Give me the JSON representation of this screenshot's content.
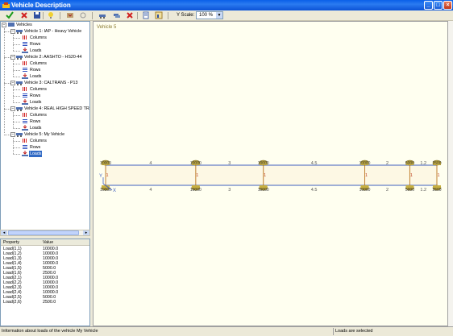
{
  "window": {
    "title": "Vehicle Description"
  },
  "toolbar": {
    "yscale_label": "Y Scale:",
    "yscale_value": "100 %"
  },
  "tree": {
    "root": "Vehicles",
    "vehicles": [
      {
        "label": "Vehicle 1: IAP - Heavy Vehicle",
        "children": [
          "Columns",
          "Rows",
          "Loads"
        ]
      },
      {
        "label": "Vehicle 2: AASHTO - HS20-44",
        "children": [
          "Columns",
          "Rows",
          "Loads"
        ]
      },
      {
        "label": "Vehicle 3: CALTRANS - P13",
        "children": [
          "Columns",
          "Rows",
          "Loads"
        ]
      },
      {
        "label": "Vehicle 4: REAL HIGH SPEED TRAI",
        "children": [
          "Columns",
          "Rows",
          "Loads"
        ]
      },
      {
        "label": "Vehicle 5: My Vehicle",
        "children": [
          "Columns",
          "Rows",
          "Loads"
        ]
      }
    ]
  },
  "properties": {
    "header": {
      "property": "Property",
      "value": "Value"
    },
    "rows": [
      [
        "Load(1,1)",
        "10000.0"
      ],
      [
        "Load(1,2)",
        "10000.0"
      ],
      [
        "Load(1,3)",
        "10000.0"
      ],
      [
        "Load(1,4)",
        "10000.0"
      ],
      [
        "Load(1,5)",
        "5000.0"
      ],
      [
        "Load(1,6)",
        "2500.0"
      ],
      [
        "Load(2,1)",
        "10000.0"
      ],
      [
        "Load(2,2)",
        "10000.0"
      ],
      [
        "Load(2,3)",
        "10000.0"
      ],
      [
        "Load(2,4)",
        "10000.0"
      ],
      [
        "Load(2,5)",
        "5000.0"
      ],
      [
        "Load(2,6)",
        "2500.0"
      ]
    ]
  },
  "canvas": {
    "vehicle_title": "Vehicle 5",
    "top_loads": [
      "10000",
      "10000",
      "10000",
      "10000",
      "5000",
      "2500"
    ],
    "bottom_loads": [
      "10000",
      "10000",
      "10000",
      "10000",
      "5000",
      "2500"
    ],
    "spacings": [
      "4",
      "3",
      "4.5",
      "2",
      "1.2"
    ],
    "row_spacing": "1",
    "axis_y": "Y",
    "axis_x": "X"
  },
  "status": {
    "left": "Information about loads of the vehicle My Vehicle",
    "right": "Loads are selected"
  }
}
